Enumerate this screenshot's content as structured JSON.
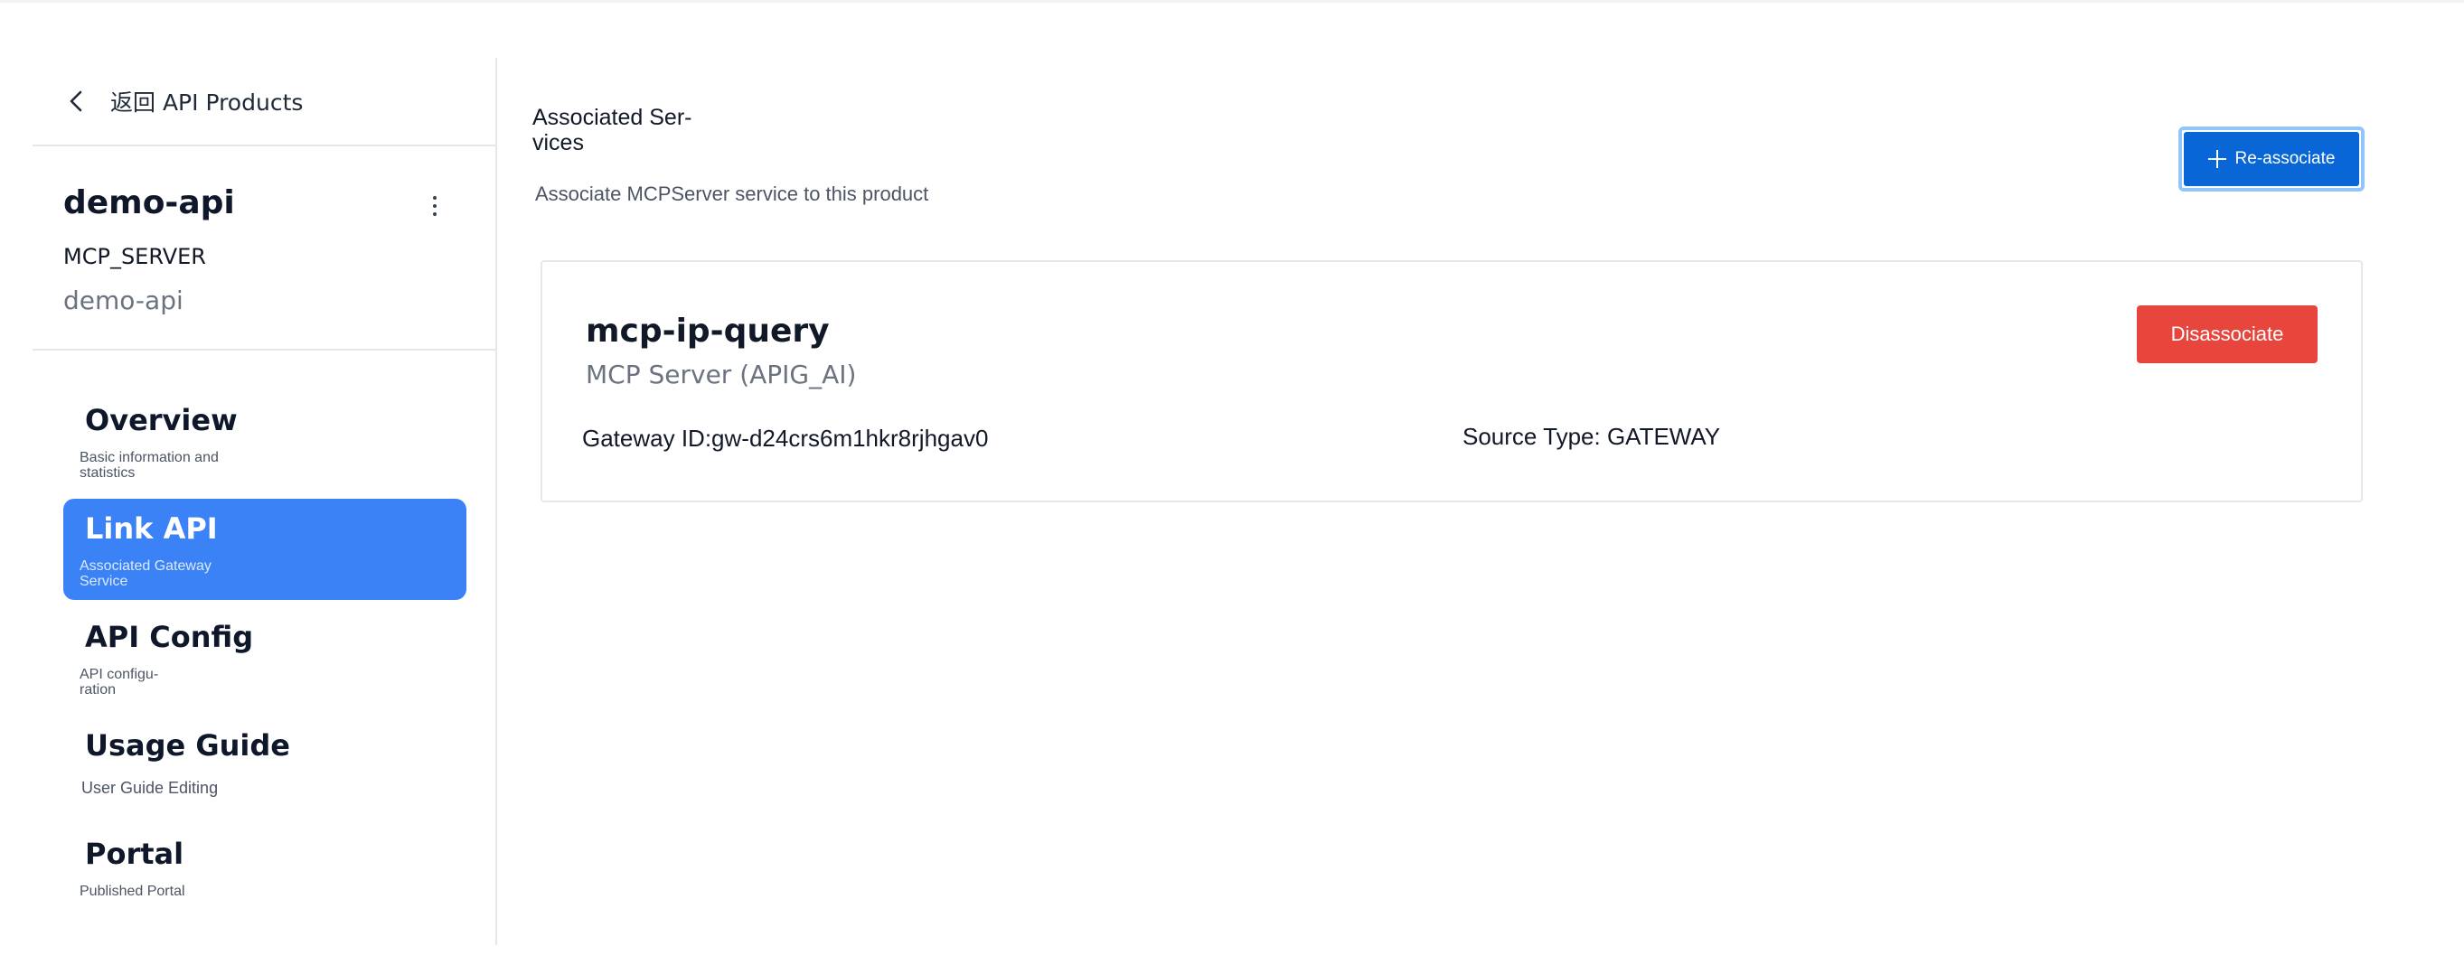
{
  "sidebar": {
    "back_label": "返回 API Products",
    "product": {
      "name": "demo-api",
      "type": "MCP_SERVER",
      "subtitle": "demo-api"
    },
    "nav": [
      {
        "title": "Overview",
        "desc": "Basic information and statistics",
        "active": false
      },
      {
        "title": "Link API",
        "desc": "Associated Gateway Service",
        "active": true
      },
      {
        "title": "API Config",
        "desc": "API configu-ration",
        "active": false
      },
      {
        "title": "Usage Guide",
        "desc": "User Guide Editing",
        "active": false
      },
      {
        "title": "Portal",
        "desc": "Published Portal",
        "active": false
      }
    ]
  },
  "main": {
    "section_title": "Associated Ser-vices",
    "section_desc": "Associate MCPServer service to this product",
    "reassociate_label": "Re-associate",
    "service": {
      "name": "mcp-ip-query",
      "type": "MCP Server (APIG_AI)",
      "disassociate_label": "Disassociate",
      "gateway_id": "Gateway ID:gw-d24crs6m1hkr8rjhgav0",
      "source_type": "Source Type: GATEWAY"
    }
  },
  "colors": {
    "primary": "#0866d6",
    "active_nav": "#3b82f6",
    "danger": "#e8453c",
    "border": "#e5e7eb"
  }
}
